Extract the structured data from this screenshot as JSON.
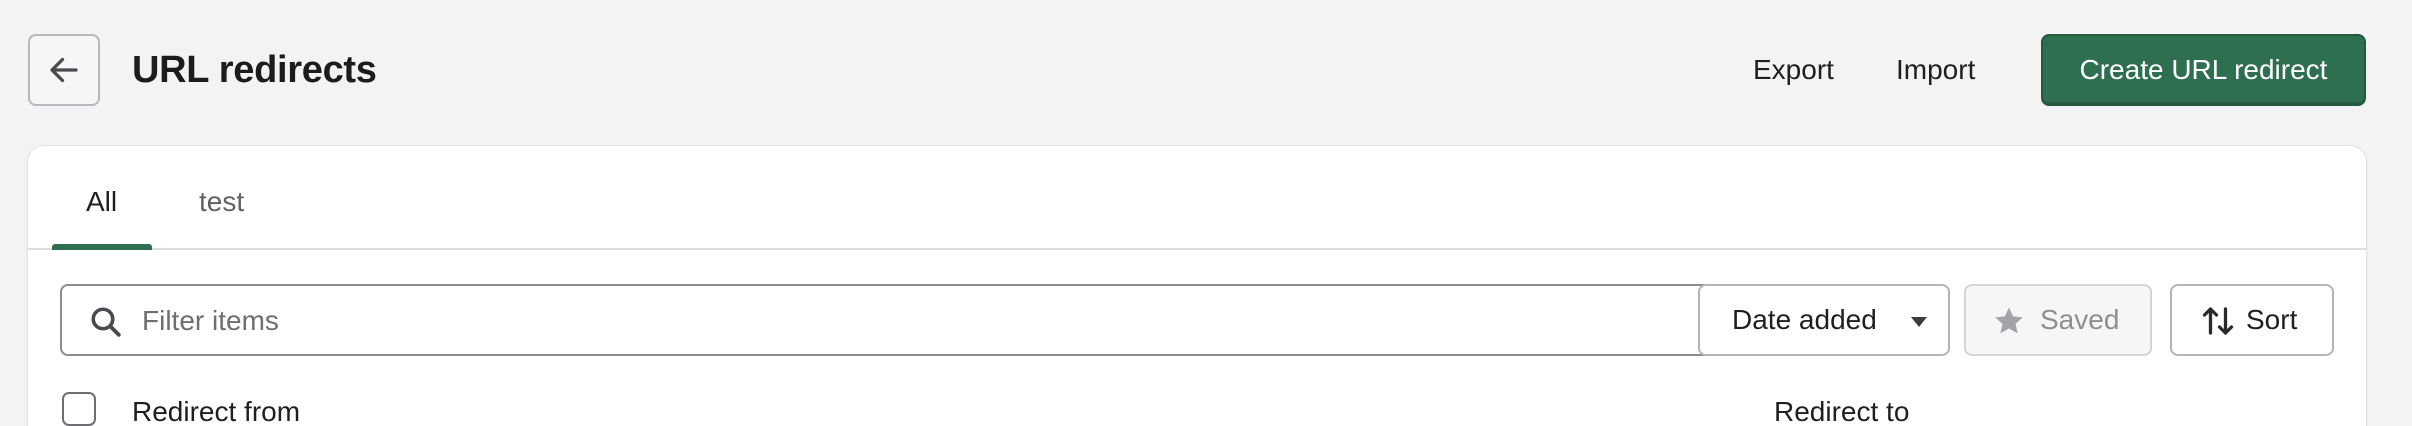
{
  "header": {
    "title": "URL redirects",
    "back_icon": "arrow-left-icon",
    "export_label": "Export",
    "import_label": "Import",
    "create_label": "Create URL redirect"
  },
  "tabs": [
    {
      "label": "All",
      "selected": true
    },
    {
      "label": "test",
      "selected": false
    }
  ],
  "toolbar": {
    "search": {
      "placeholder": "Filter items",
      "value": ""
    },
    "date_filter_label": "Date added",
    "saved_label": "Saved",
    "sort_label": "Sort"
  },
  "table": {
    "columns": [
      "Redirect from",
      "Redirect to"
    ]
  },
  "colors": {
    "primary": "#2e6f4f",
    "background": "#f3f3f4",
    "card": "#ffffff"
  }
}
